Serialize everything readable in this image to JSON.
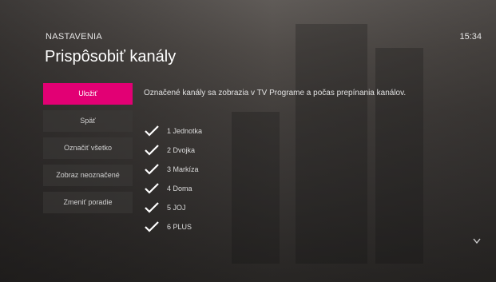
{
  "header": {
    "section": "NASTAVENIA",
    "title": "Prispôsobiť kanály",
    "time": "15:34"
  },
  "menu": {
    "items": [
      "Uložiť",
      "Späť",
      "Označiť všetko",
      "Zobraz neoznačené",
      "Zmeniť poradie"
    ],
    "selected": "Uložiť"
  },
  "description": "Označené kanály sa zobrazia v TV Programe a počas prepínania kanálov.",
  "channels": [
    {
      "label": "1 Jednotka",
      "checked": true
    },
    {
      "label": "2 Dvojka",
      "checked": true
    },
    {
      "label": "3 Markíza",
      "checked": true
    },
    {
      "label": "4 Doma",
      "checked": true
    },
    {
      "label": "5 JOJ",
      "checked": true
    },
    {
      "label": "6 PLUS",
      "checked": true
    }
  ],
  "colors": {
    "accent": "#e20074",
    "text": "#ffffff"
  },
  "icons": {
    "check": "check-icon",
    "more": "chevron-down-icon"
  }
}
